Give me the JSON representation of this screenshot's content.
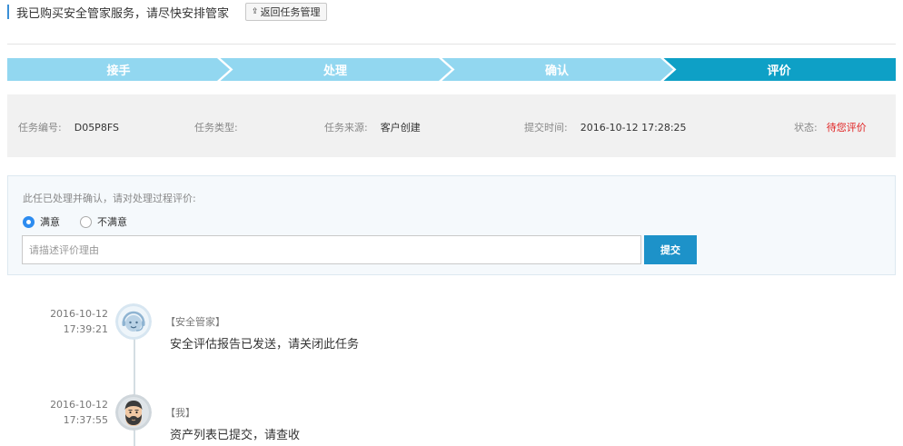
{
  "header": {
    "title": "我已购买安全管家服务，请尽快安排管家",
    "back_label": "返回任务管理"
  },
  "steps": [
    {
      "label": "接手",
      "state": "done"
    },
    {
      "label": "处理",
      "state": "done"
    },
    {
      "label": "确认",
      "state": "done"
    },
    {
      "label": "评价",
      "state": "current"
    }
  ],
  "colors": {
    "step_done": "#92d7f0",
    "step_current": "#0ea0c6",
    "accent": "#1d92c9",
    "status_red": "#e02020"
  },
  "task_info": {
    "id_label": "任务编号:",
    "id_value": "D05P8FS",
    "type_label": "任务类型:",
    "type_value": "",
    "source_label": "任务来源:",
    "source_value": "客户创建",
    "submit_time_label": "提交时间:",
    "submit_time_value": "2016-10-12 17:28:25",
    "status_label": "状态:",
    "status_value": "待您评价"
  },
  "evaluation": {
    "prompt": "此任已处理并确认，请对处理过程评价:",
    "options": [
      {
        "label": "满意",
        "selected": true
      },
      {
        "label": "不满意",
        "selected": false
      }
    ],
    "reason_placeholder": "请描述评价理由",
    "reason_value": "",
    "submit_label": "提交"
  },
  "timeline": [
    {
      "date": "2016-10-12",
      "time": "17:39:21",
      "author": "【安全管家】",
      "message": "安全评估报告已发送，请关闭此任务",
      "avatar_icon": "support-agent-avatar-icon"
    },
    {
      "date": "2016-10-12",
      "time": "17:37:55",
      "author": "【我】",
      "message": "资产列表已提交，请查收",
      "avatar_icon": "bearded-user-avatar-icon"
    }
  ]
}
